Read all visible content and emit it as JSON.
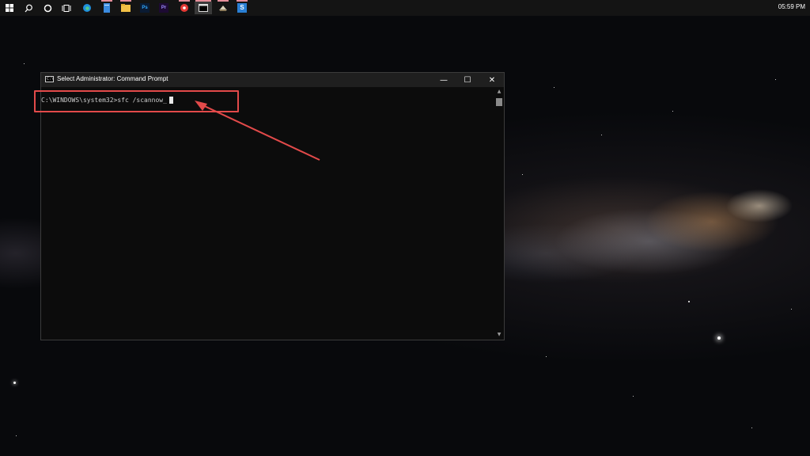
{
  "taskbar": {
    "start_icon": "windows-start-icon",
    "items": [
      {
        "name": "search-icon"
      },
      {
        "name": "cortana-icon"
      },
      {
        "name": "task-view-icon"
      },
      {
        "name": "edge-icon"
      },
      {
        "name": "files-icon"
      },
      {
        "name": "file-explorer-icon"
      },
      {
        "name": "photoshop-icon",
        "label": "Ps"
      },
      {
        "name": "premiere-icon",
        "label": "Pr"
      },
      {
        "name": "record-icon"
      },
      {
        "name": "command-prompt-icon"
      },
      {
        "name": "app-icon"
      },
      {
        "name": "snagit-icon",
        "label": "S"
      }
    ],
    "clock": "05:59 PM"
  },
  "window": {
    "title": "Select Administrator: Command Prompt",
    "minimize": "—",
    "maximize": "☐",
    "close": "✕"
  },
  "console": {
    "prompt": "C:\\WINDOWS\\system32>sfc /scannow_"
  },
  "colors": {
    "annotation": "#e24a4a",
    "console_bg": "#0c0c0c",
    "console_text": "#cccccc",
    "taskbar_bg": "#141414"
  }
}
